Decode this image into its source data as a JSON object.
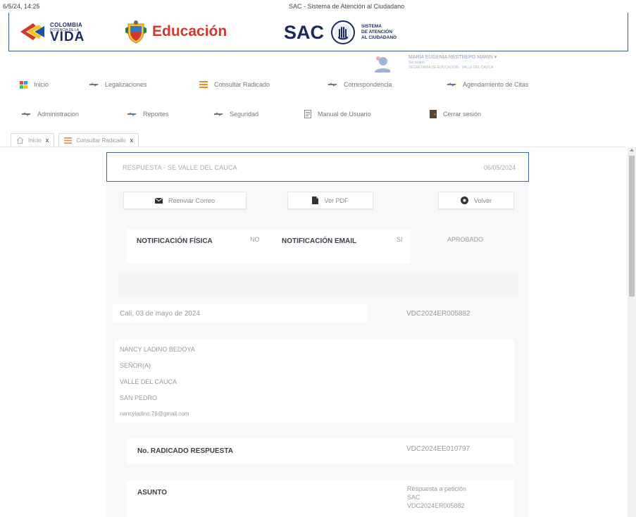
{
  "print_header": {
    "date": "6/5/24, 14:25",
    "title": "SAC - Sistema de Atención al Ciudadano"
  },
  "banner": {
    "colombia_top": "COLOMBIA",
    "colombia_tiny": "POTENCIA DE LA",
    "colombia_vida": "VIDA",
    "educacion": "Educación",
    "sac": "SAC",
    "sac_sub_1": "SISTEMA",
    "sac_sub_2": "DE ATENCIÓN",
    "sac_sub_3": "AL CIUDADANO"
  },
  "user": {
    "name": "MARIA EUGENIA RESTREPO MARIN",
    "role": "Secretaría",
    "secretaria": "SECRETARIA DE EDUCACION - VALLE DEL CAUCA"
  },
  "nav": {
    "row1": [
      {
        "label": "Inicio",
        "icon": "grid-icon"
      },
      {
        "label": "Legalizaciones",
        "icon": "arrows-icon"
      },
      {
        "label": "Consultar Radicado",
        "icon": "list-icon"
      },
      {
        "label": "Correspondencia",
        "icon": "arrows-icon"
      },
      {
        "label": "Agendamiento de Citas",
        "icon": "arrows-icon"
      }
    ],
    "row2": [
      {
        "label": "Administracion",
        "icon": "arrows-icon"
      },
      {
        "label": "Reportes",
        "icon": "arrows-icon"
      },
      {
        "label": "Seguridad",
        "icon": "arrows-icon"
      },
      {
        "label": "Manual de Usuario",
        "icon": "document-icon"
      },
      {
        "label": "Cerrar sesión",
        "icon": "door-icon"
      }
    ]
  },
  "tabs": [
    {
      "label": "Inicio",
      "close": "x",
      "icon": "home-icon"
    },
    {
      "label": "Consultar Radicado",
      "close": "x",
      "icon": "list-icon"
    }
  ],
  "response": {
    "title": "RESPUESTA - SE VALLE DEL CAUCA",
    "date": "06/05/2024",
    "buttons": {
      "reenviar": "Reenviar Correo",
      "ver_pdf": "Ver PDF",
      "volver": "Volver"
    },
    "notificacion_fisica_label": "NOTIFICACIÓN FÍSICA",
    "notificacion_fisica_value": "NO",
    "notificacion_email_label": "NOTIFICACIÓN EMAIL",
    "notificacion_email_value": "SI",
    "estado": "APROBADO",
    "fecha_ciudad": "Cali, 03 de mayo de 2024",
    "radicado_entrada": "VDC2024ER005882",
    "destinatario": {
      "nombre": "NANCY LADINO BEDOYA",
      "tratamiento": "SEÑOR(A)",
      "departamento": "VALLE DEL CAUCA",
      "municipio": "SAN PEDRO",
      "email": "nancyladino.76@gmail.com"
    },
    "radicado_respuesta_label": "No. RADICADO RESPUESTA",
    "radicado_respuesta_value": "VDC2024EE010797",
    "asunto_label": "ASUNTO",
    "asunto_line1": "Respuesta a petición",
    "asunto_line2": "SAC",
    "asunto_line3": "VDC2024ER005882"
  },
  "colors": {
    "primary_blue": "#3f63ad",
    "brand_navy": "#1b2a5c",
    "educacion_red": "#d4372c",
    "nav_arrow_orange": "#f08a24",
    "nav_arrow_blue": "#3a78c3"
  }
}
